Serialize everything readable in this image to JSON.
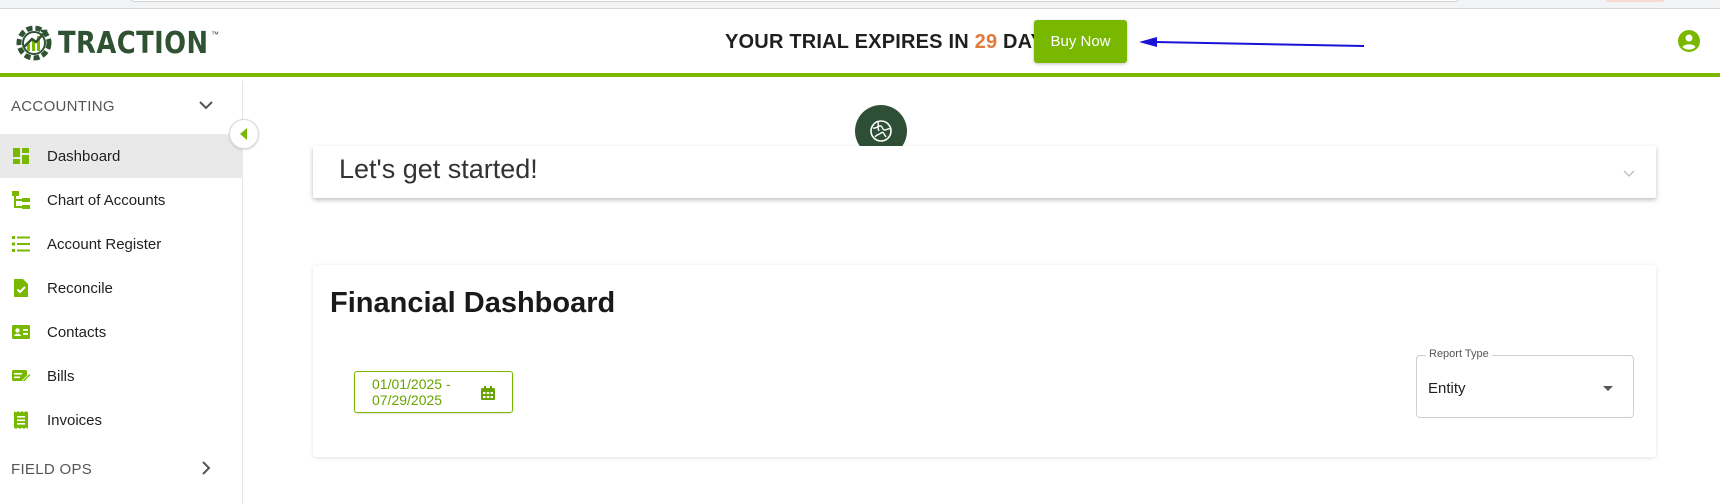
{
  "header": {
    "logo_text": "TRACTION",
    "logo_tm": "™",
    "trial_prefix": "YOUR TRIAL EXPIRES IN ",
    "trial_days": "29",
    "trial_suffix": " DAYS",
    "buy_label": "Buy Now"
  },
  "sidebar": {
    "accounting_label": "ACCOUNTING",
    "items": [
      {
        "label": "Dashboard",
        "icon": "dashboard-icon",
        "active": true
      },
      {
        "label": "Chart of Accounts",
        "icon": "tree-icon"
      },
      {
        "label": "Account Register",
        "icon": "list-icon"
      },
      {
        "label": "Reconcile",
        "icon": "doc-check-icon"
      },
      {
        "label": "Contacts",
        "icon": "contact-card-icon"
      },
      {
        "label": "Bills",
        "icon": "bill-icon"
      },
      {
        "label": "Invoices",
        "icon": "receipt-icon"
      }
    ],
    "field_ops_label": "FIELD OPS"
  },
  "main": {
    "getting_started": "Let's get started!",
    "dashboard_title": "Financial Dashboard",
    "date_range": "01/01/2025 - 07/29/2025",
    "report_type_label": "Report Type",
    "report_type_value": "Entity"
  },
  "colors": {
    "brand_green": "#78b800",
    "dark_green": "#2f5233",
    "trial_days_orange": "#e07b3c",
    "arrow_blue": "#1a12d6"
  }
}
